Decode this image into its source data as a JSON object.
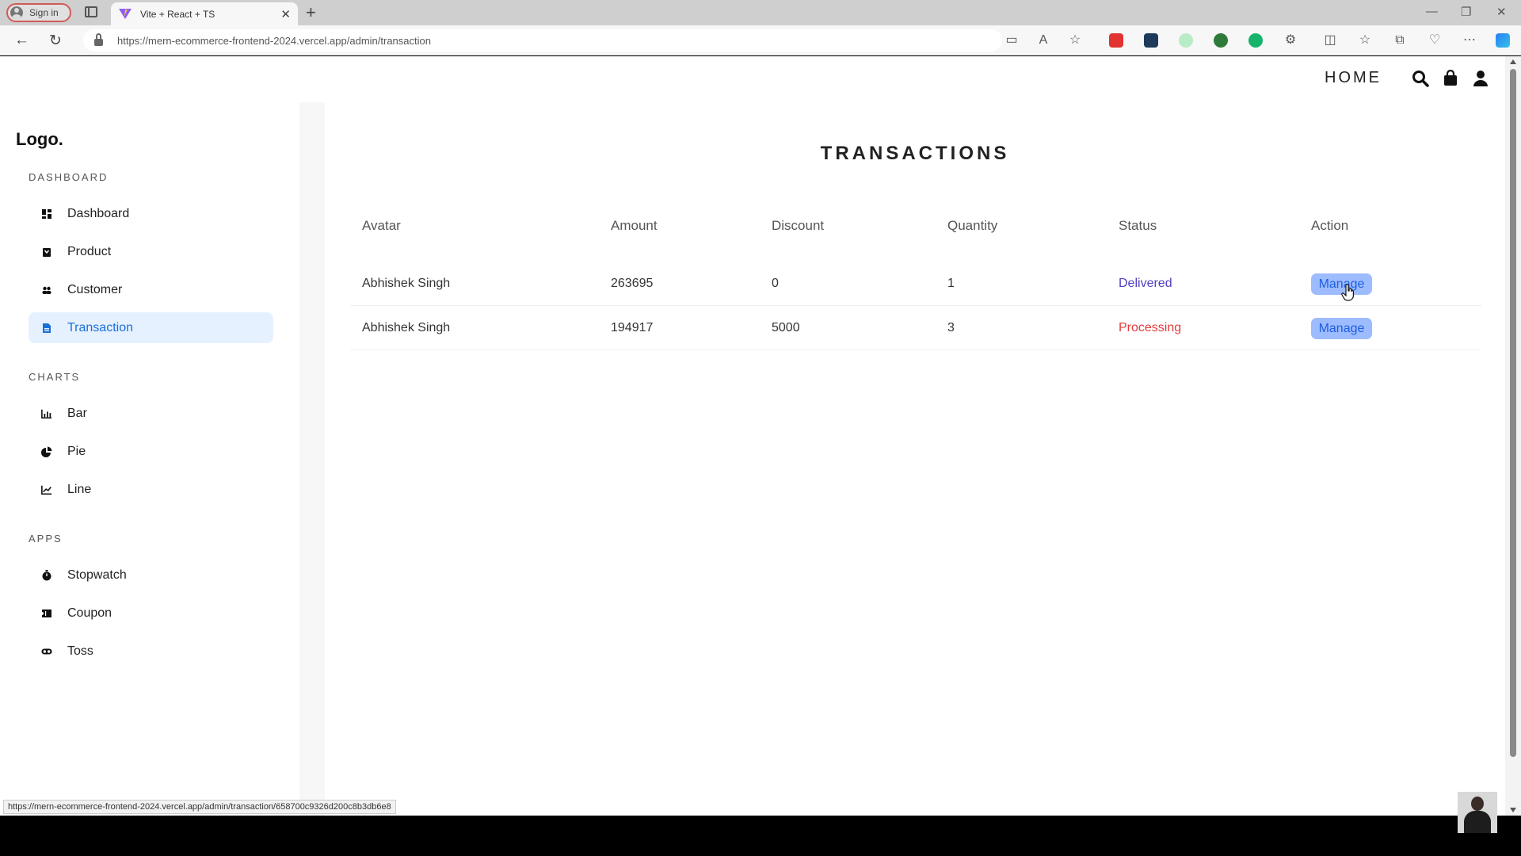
{
  "browser": {
    "signin_label": "Sign in",
    "tab_title": "Vite + React + TS",
    "url": "https://mern-ecommerce-frontend-2024.vercel.app/admin/transaction",
    "status_url": "https://mern-ecommerce-frontend-2024.vercel.app/admin/transaction/658700c9326d200c8b3db6e8"
  },
  "header": {
    "home_label": "HOME"
  },
  "sidebar": {
    "logo": "Logo.",
    "sections": [
      {
        "heading": "DASHBOARD",
        "items": [
          {
            "label": "Dashboard",
            "icon": "dashboard-icon"
          },
          {
            "label": "Product",
            "icon": "product-bag-icon"
          },
          {
            "label": "Customer",
            "icon": "customers-icon"
          },
          {
            "label": "Transaction",
            "icon": "document-icon",
            "active": true
          }
        ]
      },
      {
        "heading": "CHARTS",
        "items": [
          {
            "label": "Bar",
            "icon": "bar-chart-icon"
          },
          {
            "label": "Pie",
            "icon": "pie-chart-icon"
          },
          {
            "label": "Line",
            "icon": "line-chart-icon"
          }
        ]
      },
      {
        "heading": "APPS",
        "items": [
          {
            "label": "Stopwatch",
            "icon": "stopwatch-icon"
          },
          {
            "label": "Coupon",
            "icon": "coupon-icon"
          },
          {
            "label": "Toss",
            "icon": "coin-toss-icon"
          }
        ]
      }
    ]
  },
  "main": {
    "title": "TRANSACTIONS",
    "columns": [
      "Avatar",
      "Amount",
      "Discount",
      "Quantity",
      "Status",
      "Action"
    ],
    "rows": [
      {
        "user": "Abhishek Singh",
        "amount": "263695",
        "discount": "0",
        "quantity": "1",
        "status": "Delivered",
        "action": "Manage"
      },
      {
        "user": "Abhishek Singh",
        "amount": "194917",
        "discount": "5000",
        "quantity": "3",
        "status": "Processing",
        "action": "Manage"
      }
    ]
  },
  "colors": {
    "active_nav_bg": "#e6f1ff",
    "active_nav_text": "#1a6fd8",
    "delivered": "#4f3fbf",
    "processing": "#e03c3c",
    "manage_bg": "#9dbbff",
    "manage_text": "#1d5fe0"
  }
}
